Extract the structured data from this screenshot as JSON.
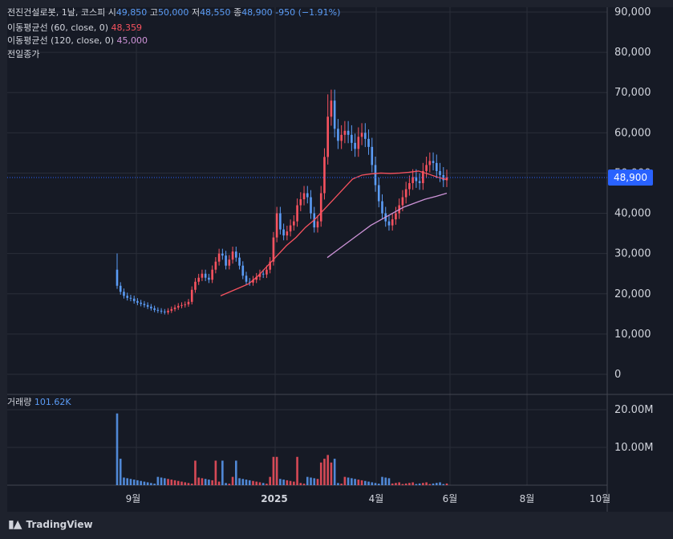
{
  "legend": {
    "symbol": "전진건설로봇, 1날, 코스피",
    "open_label": "시",
    "open": "49,850",
    "high_label": "고",
    "high": "50,000",
    "low_label": "저",
    "low": "48,550",
    "close_label": "종",
    "close": "48,900",
    "change": "-950 (−1.91%)",
    "ma60_label": "이동평균선 (60, close, 0)",
    "ma60_value": "48,359",
    "ma120_label": "이동평균선 (120, close, 0)",
    "ma120_value": "45,000",
    "prev_close_label": "전일종가"
  },
  "volume": {
    "label": "거래량",
    "value": "101.62K"
  },
  "price_tag": "48,900",
  "footer": {
    "brand": "TradingView"
  },
  "colors": {
    "up": "#f7525f",
    "down": "#5b9cf6",
    "ma60": "#f7525f",
    "ma120": "#ce93d8",
    "price_line": "#2962ff"
  },
  "chart_data": {
    "type": "candlestick",
    "price_axis": {
      "ticks": [
        "90,000",
        "80,000",
        "70,000",
        "60,000",
        "50,000",
        "40,000",
        "30,000",
        "20,000",
        "10,000",
        "0"
      ],
      "range": [
        0,
        90000
      ]
    },
    "volume_axis": {
      "ticks": [
        "20.00M",
        "10.00M"
      ],
      "range": [
        0,
        20000000
      ]
    },
    "time_axis": {
      "ticks": [
        "9월",
        "2025",
        "4월",
        "6월",
        "8월",
        "10월"
      ]
    },
    "last_price": 48900,
    "series": [
      {
        "name": "price",
        "close": [
          22000,
          20500,
          19500,
          19000,
          18800,
          18200,
          17800,
          17500,
          17200,
          16800,
          16400,
          16000,
          15800,
          15600,
          15400,
          15800,
          16200,
          16600,
          17000,
          17200,
          17400,
          18000,
          21000,
          23000,
          24000,
          25000,
          24000,
          23500,
          26000,
          28000,
          30000,
          29500,
          27000,
          28500,
          30500,
          29000,
          27000,
          24500,
          23000,
          22800,
          23500,
          24200,
          25000,
          24800,
          26000,
          28000,
          34000,
          40000,
          36000,
          34500,
          35500,
          37000,
          38000,
          42000,
          43500,
          45000,
          44000,
          40000,
          36500,
          38000,
          45000,
          54000,
          64000,
          68000,
          61000,
          58000,
          59500,
          60500,
          59500,
          57500,
          56000,
          59000,
          60000,
          58500,
          56500,
          52000,
          47000,
          43000,
          40000,
          38000,
          37000,
          38500,
          40000,
          42000,
          44000,
          46000,
          47500,
          49000,
          48000,
          47500,
          50500,
          52000,
          53000,
          52500,
          50500,
          49500,
          48200,
          48900
        ]
      },
      {
        "name": "이동평균선 (60, close, 0)",
        "values": [
          19500,
          20500,
          21500,
          22500,
          24500,
          27000,
          29500,
          32000,
          34000,
          36500,
          38500,
          41000,
          43500,
          46000,
          48500,
          49500,
          49800,
          50000,
          49900,
          50000,
          50200,
          50500,
          49800,
          49000,
          48359
        ]
      },
      {
        "name": "이동평균선 (120, close, 0)",
        "values": [
          29000,
          31000,
          33000,
          35000,
          37000,
          38500,
          40000,
          41500,
          42500,
          43500,
          44200,
          45000
        ]
      }
    ]
  }
}
